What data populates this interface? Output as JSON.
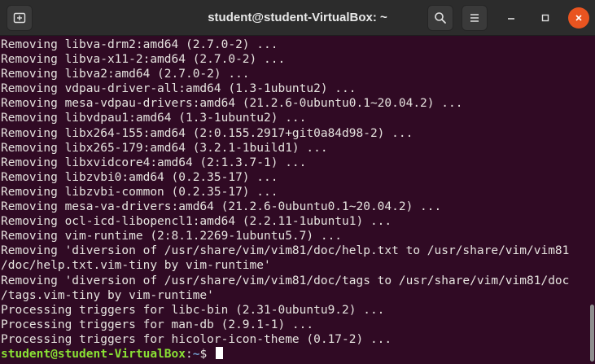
{
  "window": {
    "title": "student@student-VirtualBox: ~"
  },
  "icons": {
    "new_tab": "new-tab-icon",
    "search": "search-icon",
    "menu": "hamburger-menu-icon",
    "minimize": "minimize-icon",
    "maximize": "maximize-icon",
    "close": "close-icon"
  },
  "colors": {
    "terminal_bg": "#300a24",
    "prompt_user": "#8ae234",
    "prompt_path": "#729fcf",
    "close_button": "#e95420"
  },
  "terminal": {
    "lines": [
      "Removing libva-drm2:amd64 (2.7.0-2) ...",
      "Removing libva-x11-2:amd64 (2.7.0-2) ...",
      "Removing libva2:amd64 (2.7.0-2) ...",
      "Removing vdpau-driver-all:amd64 (1.3-1ubuntu2) ...",
      "Removing mesa-vdpau-drivers:amd64 (21.2.6-0ubuntu0.1~20.04.2) ...",
      "Removing libvdpau1:amd64 (1.3-1ubuntu2) ...",
      "Removing libx264-155:amd64 (2:0.155.2917+git0a84d98-2) ...",
      "Removing libx265-179:amd64 (3.2.1-1build1) ...",
      "Removing libxvidcore4:amd64 (2:1.3.7-1) ...",
      "Removing libzvbi0:amd64 (0.2.35-17) ...",
      "Removing libzvbi-common (0.2.35-17) ...",
      "Removing mesa-va-drivers:amd64 (21.2.6-0ubuntu0.1~20.04.2) ...",
      "Removing ocl-icd-libopencl1:amd64 (2.2.11-1ubuntu1) ...",
      "Removing vim-runtime (2:8.1.2269-1ubuntu5.7) ...",
      "Removing 'diversion of /usr/share/vim/vim81/doc/help.txt to /usr/share/vim/vim81",
      "/doc/help.txt.vim-tiny by vim-runtime'",
      "Removing 'diversion of /usr/share/vim/vim81/doc/tags to /usr/share/vim/vim81/doc",
      "/tags.vim-tiny by vim-runtime'",
      "Processing triggers for libc-bin (2.31-0ubuntu9.2) ...",
      "Processing triggers for man-db (2.9.1-1) ...",
      "Processing triggers for hicolor-icon-theme (0.17-2) ..."
    ],
    "prompt": {
      "user_host": "student@student-VirtualBox",
      "separator": ":",
      "path": "~",
      "symbol": "$ "
    }
  }
}
